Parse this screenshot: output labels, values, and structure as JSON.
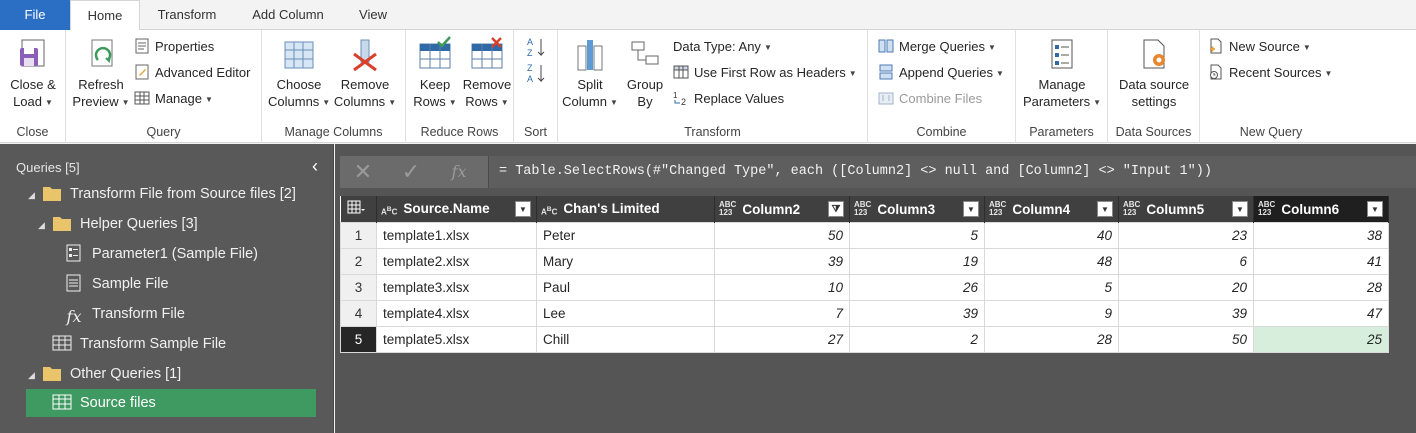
{
  "menu_tabs": [
    "File",
    "Home",
    "Transform",
    "Add Column",
    "View"
  ],
  "ribbon": {
    "close": {
      "close_load": "Close &",
      "close_load2": "Load",
      "group": "Close"
    },
    "query": {
      "refresh": "Refresh",
      "refresh2": "Preview",
      "properties": "Properties",
      "advanced_editor": "Advanced Editor",
      "manage": "Manage",
      "group": "Query"
    },
    "manage_columns": {
      "choose": "Choose",
      "choose2": "Columns",
      "remove": "Remove",
      "remove2": "Columns",
      "group": "Manage Columns"
    },
    "reduce_rows": {
      "keep": "Keep",
      "keep2": "Rows",
      "remove": "Remove",
      "remove2": "Rows",
      "group": "Reduce Rows"
    },
    "sort": {
      "group": "Sort"
    },
    "transform": {
      "split": "Split",
      "split2": "Column",
      "group_by": "Group",
      "group_by2": "By",
      "data_type": "Data Type: Any",
      "first_row": "Use First Row as Headers",
      "replace": "Replace Values",
      "group": "Transform"
    },
    "combine": {
      "merge": "Merge Queries",
      "append": "Append Queries",
      "combine_files": "Combine Files",
      "group": "Combine"
    },
    "parameters": {
      "manage": "Manage",
      "manage2": "Parameters",
      "group": "Parameters"
    },
    "data_sources": {
      "settings": "Data source",
      "settings2": "settings",
      "group": "Data Sources"
    },
    "new_query": {
      "new_source": "New Source",
      "recent_sources": "Recent Sources",
      "group": "New Query"
    }
  },
  "queries_panel": {
    "header": "Queries [5]",
    "items": [
      {
        "label": "Transform File from Source files [2]",
        "type": "folder"
      },
      {
        "label": "Helper Queries [3]",
        "type": "folder"
      },
      {
        "label": "Parameter1 (Sample File)",
        "type": "parameter"
      },
      {
        "label": "Sample File",
        "type": "document"
      },
      {
        "label": "Transform File",
        "type": "function"
      },
      {
        "label": "Transform Sample File",
        "type": "table"
      },
      {
        "label": "Other Queries [1]",
        "type": "folder"
      },
      {
        "label": "Source files",
        "type": "table"
      }
    ]
  },
  "formula": "= Table.SelectRows(#\"Changed Type\", each ([Column2] <> null and [Column2] <> \"Input 1\"))",
  "table": {
    "columns": [
      "Source.Name",
      "Chan's Limited",
      "Column2",
      "Column3",
      "Column4",
      "Column5",
      "Column6"
    ],
    "rows": [
      {
        "idx": "1",
        "cells": [
          "template1.xlsx",
          "Peter",
          "50",
          "5",
          "40",
          "23",
          "38"
        ]
      },
      {
        "idx": "2",
        "cells": [
          "template2.xlsx",
          "Mary",
          "39",
          "19",
          "48",
          "6",
          "41"
        ]
      },
      {
        "idx": "3",
        "cells": [
          "template3.xlsx",
          "Paul",
          "10",
          "26",
          "5",
          "20",
          "28"
        ]
      },
      {
        "idx": "4",
        "cells": [
          "template4.xlsx",
          "Lee",
          "7",
          "39",
          "9",
          "39",
          "47"
        ]
      },
      {
        "idx": "5",
        "cells": [
          "template5.xlsx",
          "Chill",
          "27",
          "2",
          "28",
          "50",
          "25"
        ]
      }
    ]
  },
  "colors": {
    "file_tab": "#2b6fc5",
    "selected_query": "#3f9a62",
    "highlight_cell": "#d7eedd"
  }
}
